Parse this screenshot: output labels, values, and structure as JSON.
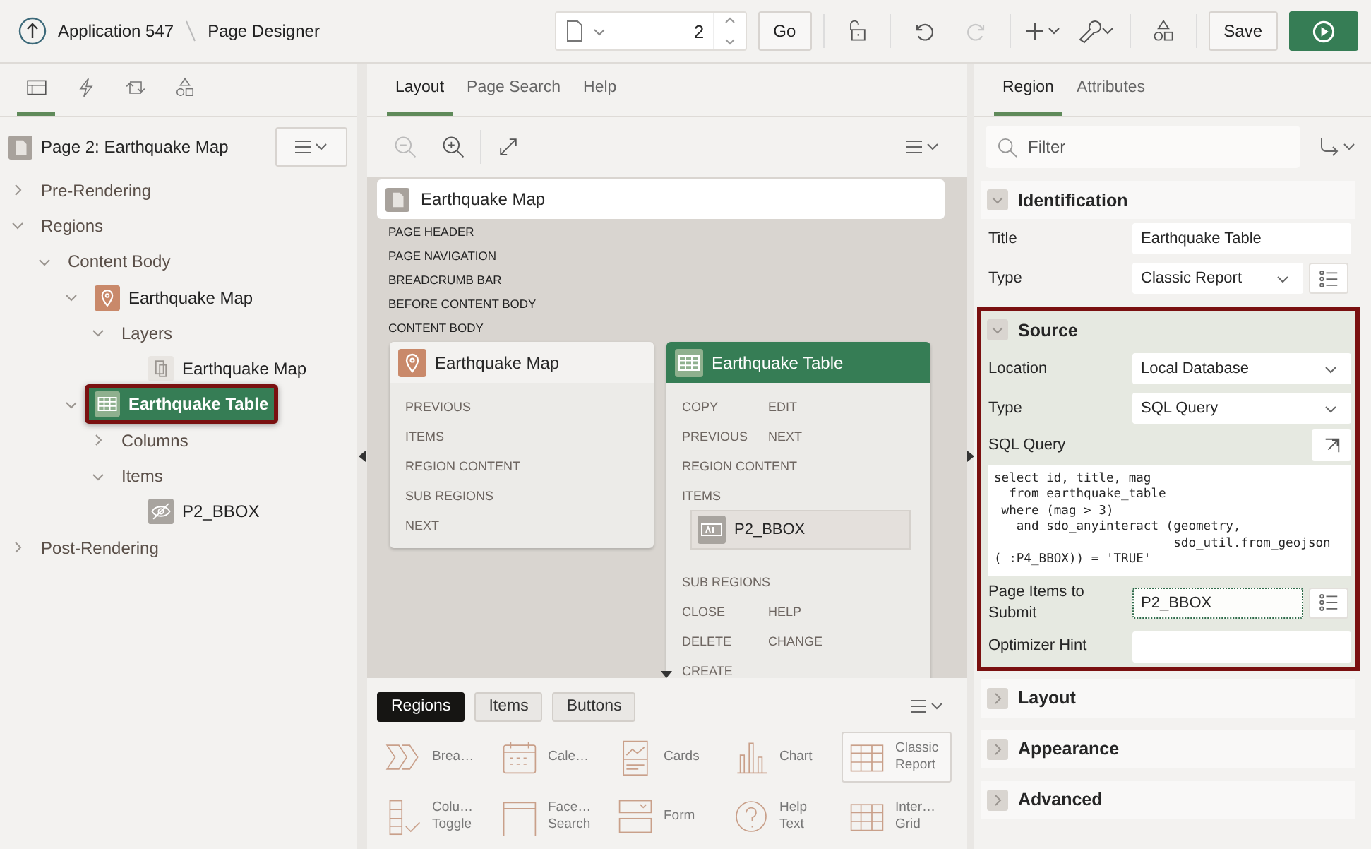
{
  "header": {
    "breadcrumb": [
      "Application 547",
      "Page Designer"
    ],
    "page_number": "2",
    "go_label": "Go",
    "history": [
      {
        "kind": "undo",
        "disabled": false
      },
      {
        "kind": "redo",
        "disabled": true
      }
    ],
    "save_label": "Save"
  },
  "left_panel": {
    "tabs": [
      {
        "kind": "rendering",
        "selected": true
      },
      {
        "kind": "dynamic-actions",
        "selected": false
      },
      {
        "kind": "processing",
        "selected": false
      },
      {
        "kind": "shared",
        "selected": false
      }
    ],
    "page_title": "Page 2: Earthquake Map",
    "tree": [
      {
        "label": "Pre-Rendering",
        "expanded": false,
        "selected": false,
        "highlighted": false
      },
      {
        "label": "Regions",
        "expanded": true,
        "selected": false,
        "highlighted": false,
        "children": [
          {
            "label": "Content Body",
            "expanded": true,
            "selected": false,
            "highlighted": false,
            "children": [
              {
                "label": "Earthquake Map",
                "kind": "map",
                "expanded": true,
                "selected": false,
                "highlighted": false,
                "children": [
                  {
                    "label": "Layers",
                    "expanded": true,
                    "selected": false,
                    "highlighted": false,
                    "children": [
                      {
                        "label": "Earthquake Map",
                        "kind": "layer",
                        "selected": false,
                        "highlighted": false
                      }
                    ]
                  }
                ]
              },
              {
                "label": "Earthquake Table",
                "kind": "table",
                "expanded": true,
                "selected": true,
                "highlighted": true,
                "children": [
                  {
                    "label": "Columns",
                    "expanded": false,
                    "selected": false,
                    "highlighted": false
                  },
                  {
                    "label": "Items",
                    "expanded": true,
                    "selected": false,
                    "highlighted": false,
                    "children": [
                      {
                        "label": "P2_BBOX",
                        "kind": "hidden",
                        "selected": false,
                        "highlighted": false
                      }
                    ]
                  }
                ]
              }
            ]
          }
        ]
      },
      {
        "label": "Post-Rendering",
        "expanded": false,
        "selected": false,
        "highlighted": false
      }
    ]
  },
  "center": {
    "tabs": [
      {
        "label": "Layout",
        "selected": true
      },
      {
        "label": "Page Search",
        "selected": false
      },
      {
        "label": "Help",
        "selected": false
      }
    ],
    "page_card_title": "Earthquake Map",
    "positions": [
      "PAGE HEADER",
      "PAGE NAVIGATION",
      "BREADCRUMB BAR",
      "BEFORE CONTENT BODY",
      "CONTENT BODY"
    ],
    "regions": [
      {
        "title": "Earthquake Map",
        "kind": "map",
        "selected": false,
        "rows": [
          {
            "kind": "slots",
            "slots": [
              "PREVIOUS"
            ]
          },
          {
            "kind": "slots",
            "slots": [
              "ITEMS"
            ]
          },
          {
            "kind": "slots",
            "slots": [
              "REGION CONTENT"
            ]
          },
          {
            "kind": "slots",
            "slots": [
              "SUB REGIONS"
            ]
          },
          {
            "kind": "slots",
            "slots": [
              "NEXT"
            ]
          }
        ]
      },
      {
        "title": "Earthquake Table",
        "kind": "table",
        "selected": true,
        "rows": [
          {
            "kind": "slots",
            "slots": [
              "COPY",
              "EDIT"
            ]
          },
          {
            "kind": "slots",
            "slots": [
              "PREVIOUS",
              "NEXT"
            ]
          },
          {
            "kind": "slots",
            "slots": [
              "REGION CONTENT"
            ]
          },
          {
            "kind": "slots",
            "slots": [
              "ITEMS"
            ]
          },
          {
            "kind": "item",
            "label": "P2_BBOX"
          },
          {
            "kind": "slots",
            "slots": [
              "SUB REGIONS"
            ]
          },
          {
            "kind": "slots",
            "slots": [
              "CLOSE",
              "HELP"
            ]
          },
          {
            "kind": "slots",
            "slots": [
              "DELETE",
              "CHANGE"
            ]
          },
          {
            "kind": "slots",
            "slots": [
              "CREATE"
            ]
          }
        ]
      }
    ],
    "gallery_tabs": [
      {
        "label": "Regions",
        "selected": true
      },
      {
        "label": "Items",
        "selected": false
      },
      {
        "label": "Buttons",
        "selected": false
      }
    ],
    "gallery": [
      {
        "label": "Brea…",
        "kind": "breadcrumb",
        "selected": false
      },
      {
        "label": "Cale…",
        "kind": "calendar",
        "selected": false
      },
      {
        "label": "Cards",
        "kind": "cards",
        "selected": false
      },
      {
        "label": "Chart",
        "kind": "chart",
        "selected": false
      },
      {
        "label": "Classic Report",
        "kind": "grid",
        "selected": true
      },
      {
        "label": "Colu… Toggle",
        "kind": "column",
        "selected": false
      },
      {
        "label": "Face… Search",
        "kind": "facet",
        "selected": false
      },
      {
        "label": "Form",
        "kind": "form",
        "selected": false
      },
      {
        "label": "Help Text",
        "kind": "help",
        "selected": false
      },
      {
        "label": "Inter… Grid",
        "kind": "grid",
        "selected": false
      }
    ]
  },
  "right_panel": {
    "tabs": [
      {
        "label": "Region",
        "selected": true
      },
      {
        "label": "Attributes",
        "selected": false
      }
    ],
    "filter": {
      "placeholder": "Filter"
    },
    "sections": [
      {
        "title": "Identification",
        "expanded": true,
        "highlighted": false,
        "fields": [
          {
            "label": "Title",
            "kind": "text",
            "value": "Earthquake Table",
            "picker": false,
            "focused": false
          },
          {
            "label": "Type",
            "kind": "select",
            "value": "Classic Report",
            "picker": true,
            "focused": false
          }
        ]
      },
      {
        "title": "Source",
        "expanded": true,
        "highlighted": true,
        "fields": [
          {
            "label": "Location",
            "kind": "select",
            "value": "Local Database",
            "picker": false,
            "focused": false
          },
          {
            "label": "Type",
            "kind": "select",
            "value": "SQL Query",
            "picker": false,
            "focused": false
          },
          {
            "label": "SQL Query",
            "kind": "code",
            "value": "select id, title, mag\n  from earthquake_table\n where (mag > 3)\n   and sdo_anyinteract (geometry,\n                        sdo_util.from_geojson\n( :P4_BBOX)) = 'TRUE'"
          },
          {
            "label": "Page Items to Submit",
            "kind": "text",
            "value": "P2_BBOX",
            "picker": true,
            "focused": true
          },
          {
            "label": "Optimizer Hint",
            "kind": "text",
            "picker": false,
            "focused": false
          }
        ]
      },
      {
        "title": "Layout",
        "expanded": false,
        "highlighted": false
      },
      {
        "title": "Appearance",
        "expanded": false,
        "highlighted": false
      },
      {
        "title": "Advanced",
        "expanded": false,
        "highlighted": false
      }
    ]
  }
}
